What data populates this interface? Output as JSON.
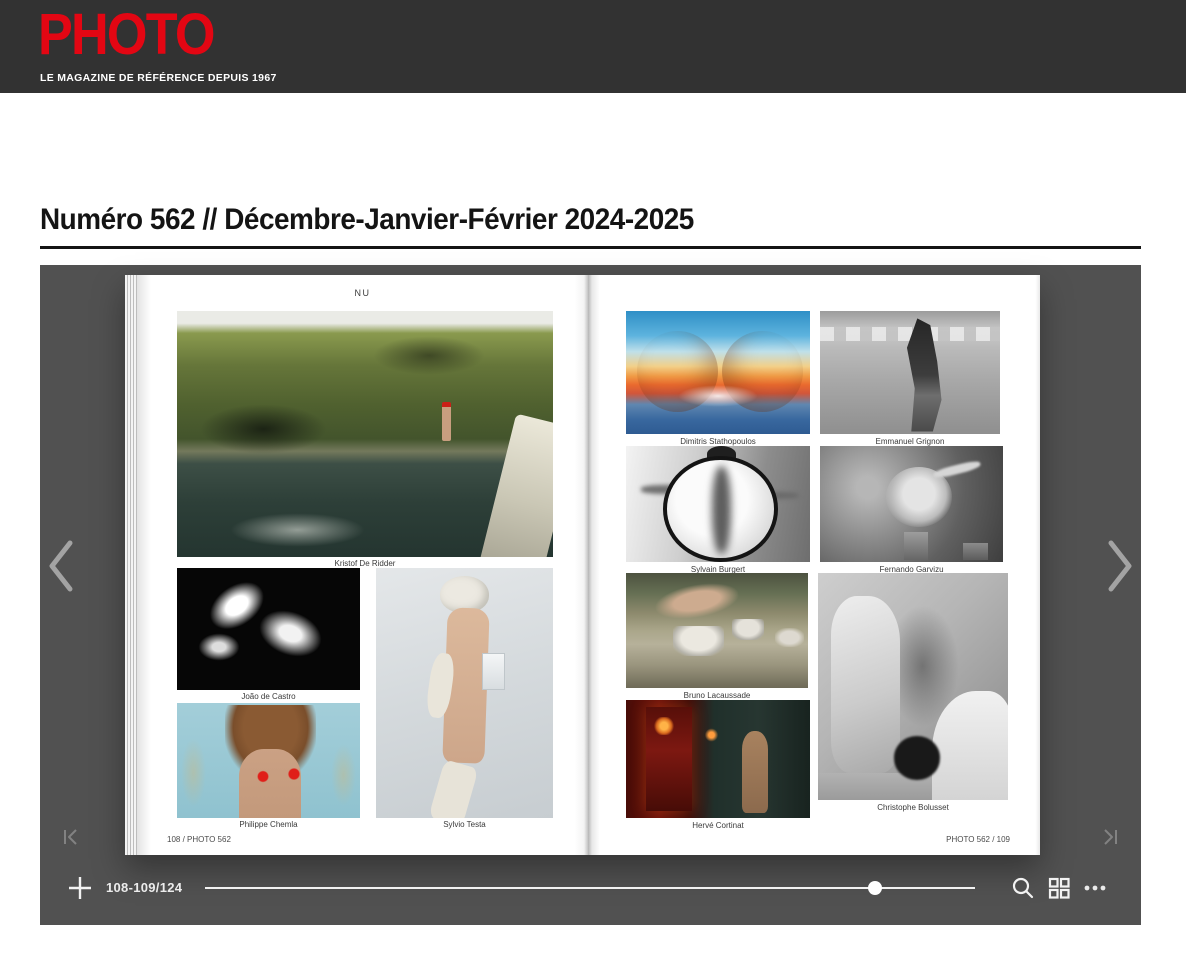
{
  "header": {
    "logo": "PHOTO",
    "tagline": "LE MAGAZINE DE RÉFÉRENCE DEPUIS 1967"
  },
  "page": {
    "title": "Numéro 562 // Décembre-Janvier-Février 2024-2025"
  },
  "viewer": {
    "left_page": {
      "section_heading": "NU",
      "photos": [
        {
          "caption": "Kristof De Ridder"
        },
        {
          "caption": "João de Castro"
        },
        {
          "caption": "Sylvio Testa"
        },
        {
          "caption": "Philippe Chemla"
        }
      ],
      "footer": "108 / PHOTO 562"
    },
    "right_page": {
      "photos": [
        {
          "caption": "Dimitris Stathopoulos"
        },
        {
          "caption": "Emmanuel Grignon"
        },
        {
          "caption": "Sylvain Burgert"
        },
        {
          "caption": "Fernando Garvizu"
        },
        {
          "caption": "Bruno Lacaussade"
        },
        {
          "caption": "Christophe Bolusset"
        },
        {
          "caption": "Hervé Cortinat"
        }
      ],
      "footer": "PHOTO 562 / 109"
    },
    "toolbar": {
      "page_indicator": "108-109/124",
      "slider_fraction": 0.87
    }
  },
  "colors": {
    "brand_red": "#e30613",
    "header_bg": "#323232",
    "viewer_bg": "#515151"
  }
}
